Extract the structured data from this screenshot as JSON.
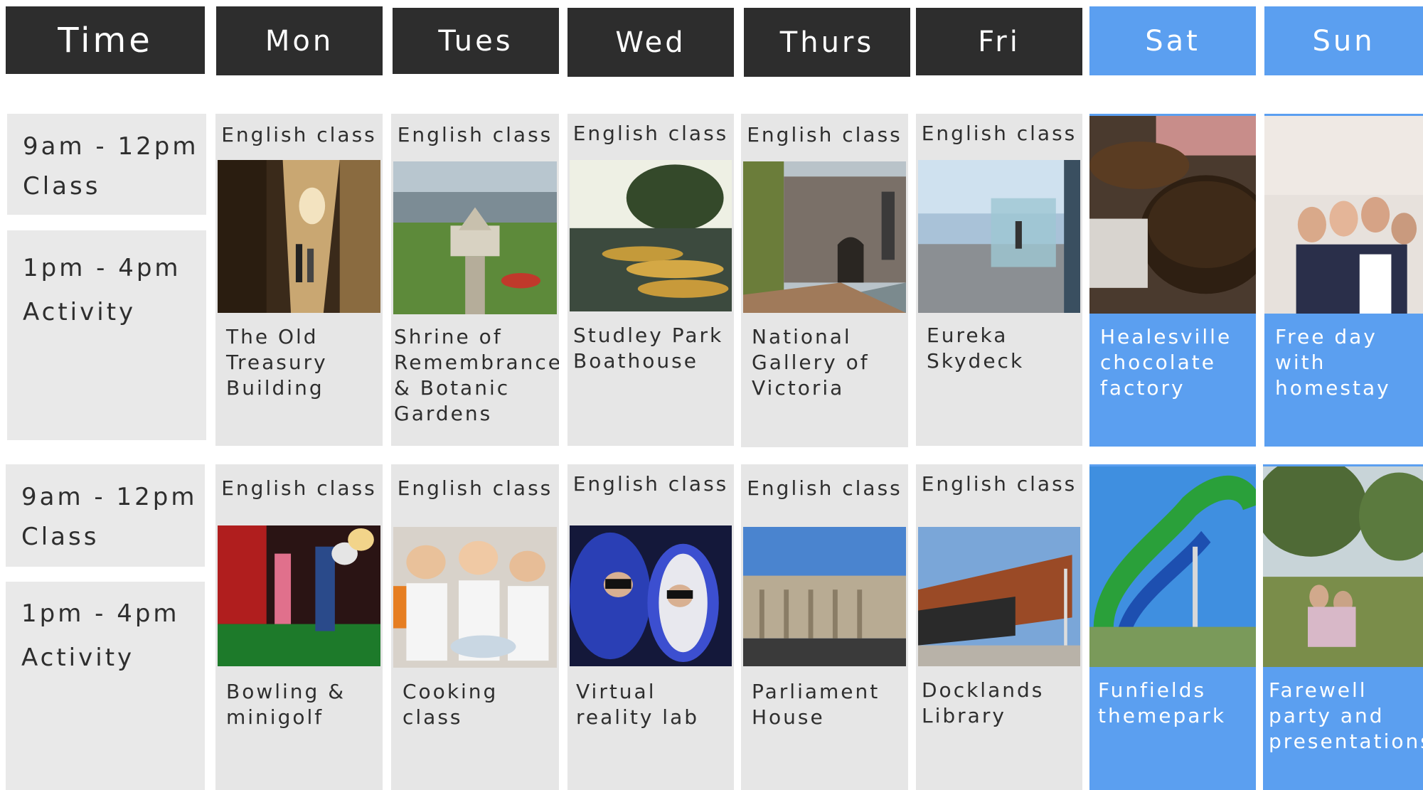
{
  "header": {
    "time_label": "Time",
    "days": [
      "Mon",
      "Tues",
      "Wed",
      "Thurs",
      "Fri",
      "Sat",
      "Sun"
    ]
  },
  "time_slots": {
    "morning_time": "9am - 12pm",
    "morning_label": "Class",
    "afternoon_time": "1pm - 4pm",
    "afternoon_label": "Activity"
  },
  "week1": [
    {
      "class": "English class",
      "activity": "The Old\nTreasury\nBuilding",
      "photo": "old-treasury-corridor"
    },
    {
      "class": "English class",
      "activity": "Shrine of\nRemembrance\n& Botanic\nGardens",
      "photo": "shrine-aerial"
    },
    {
      "class": "English class",
      "activity": "Studley Park\nBoathouse",
      "photo": "boathouse-boats"
    },
    {
      "class": "English class",
      "activity": "National\nGallery of\nVictoria",
      "photo": "gallery-building"
    },
    {
      "class": "English class",
      "activity": "Eureka\nSkydeck",
      "photo": "skydeck-glass"
    },
    {
      "activity": "Healesville\nchocolate\nfactory",
      "photo": "chocolate-bowls"
    },
    {
      "activity": "Free day\nwith\nhomestay",
      "photo": "homestay-group"
    }
  ],
  "week2": [
    {
      "class": "English class",
      "activity": "Bowling &\nminigolf",
      "photo": "minigolf"
    },
    {
      "class": "English class",
      "activity": "Cooking\nclass",
      "photo": "cooking-kids"
    },
    {
      "class": "English class",
      "activity": "Virtual\nreality lab",
      "photo": "vr-headsets"
    },
    {
      "class": "English class",
      "activity": "Parliament\nHouse",
      "photo": "parliament-building"
    },
    {
      "class": "English class",
      "activity": "Docklands\nLibrary",
      "photo": "docklands-library"
    },
    {
      "activity": "Funfields\nthemepark",
      "photo": "waterslide"
    },
    {
      "activity": "Farewell\nparty and\npresentations",
      "photo": "park-party"
    }
  ],
  "colors": {
    "header_dark": "#2d2d2d",
    "weekend_blue": "#5b9ff0",
    "cell_grey": "#e6e6e6",
    "text_dark": "#2e2e2e"
  }
}
